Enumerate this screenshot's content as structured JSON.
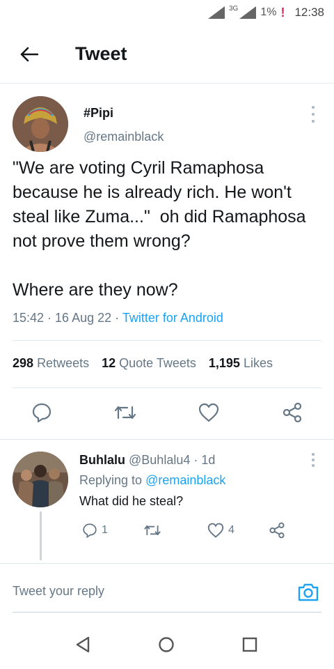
{
  "status_bar": {
    "network": "3G",
    "battery": "1%",
    "battery_warning": "!",
    "time": "12:38"
  },
  "header": {
    "back_icon": "arrow-left-icon",
    "title": "Tweet"
  },
  "tweet": {
    "display_name": "#Pipi",
    "handle": "@remainblack",
    "text": "\"We are voting Cyril Ramaphosa because he is already rich. He won't steal like Zuma...\"  oh did Ramaphosa not prove them wrong?\n\nWhere are they now?",
    "time": "15:42",
    "date": "16 Aug 22",
    "source": "Twitter for Android",
    "stats": {
      "retweets_count": "298",
      "retweets_label": "Retweets",
      "quotes_count": "12",
      "quotes_label": "Quote Tweets",
      "likes_count": "1,195",
      "likes_label": "Likes"
    },
    "actions": [
      "reply-icon",
      "retweet-icon",
      "like-icon",
      "share-icon"
    ]
  },
  "reply": {
    "display_name": "Buhlalu",
    "handle": "@Buhlalu4",
    "age": "1d",
    "replying_prefix": "Replying to",
    "replying_to": "@remainblack",
    "text": "What did he steal?",
    "reply_count": "1",
    "like_count": "4"
  },
  "composer": {
    "placeholder": "Tweet your reply",
    "camera_icon": "camera-icon"
  },
  "nav": [
    "back-triangle-icon",
    "home-circle-icon",
    "recents-square-icon"
  ],
  "colors": {
    "accent": "#1da1f2",
    "secondary_text": "#657786",
    "primary_text": "#14171a",
    "divider": "#e1e8ed",
    "warning": "#e0245e"
  }
}
